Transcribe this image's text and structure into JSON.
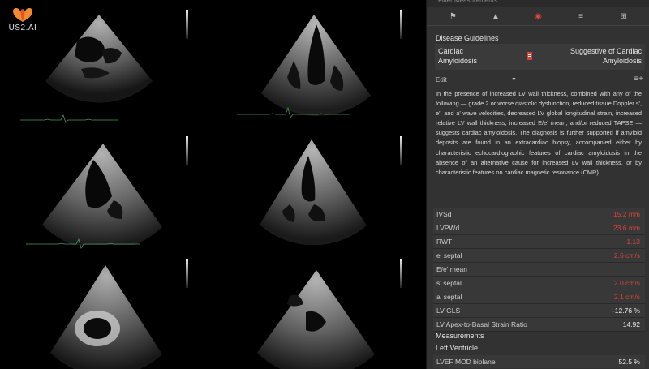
{
  "app": {
    "logo_text": "US2.AI"
  },
  "panel": {
    "filter_header": "Filter Measurements",
    "toolbar": {
      "icons": [
        "flag-icon",
        "warning-icon",
        "eye-icon",
        "menu-icon",
        "grid-icon"
      ],
      "active_icon": "eye-icon",
      "accent_color": "#e0463c"
    },
    "disease_guidelines": {
      "title": "Disease Guidelines",
      "left_line1": "Cardiac",
      "left_line2": "Amyloidosis",
      "right_line1": "Suggestive of Cardiac",
      "right_line2": "Amyloidosis"
    },
    "edit_label": "Edit",
    "guideline_text": "In the presence of increased LV wall thickness, combined with any of the following — grade 2 or worse diastolic dysfunction, reduced tissue Doppler s', e', and a' wave velocities, decreased LV global longitudinal strain, increased relative LV wall thickness, increased E/e' mean, and/or reduced TAPSE — suggests cardiac amyloidosis. The diagnosis is further supported if amyloid deposits are found in an extracardiac biopsy, accompanied either by characteristic echocardiographic features of cardiac amyloidosis in the absence of an alternative cause for increased LV wall thickness, or by characteristic features on cardiac magnetic resonance (CMR).",
    "measurements_rows": [
      {
        "label": "IVSd",
        "value": "15.2 mm",
        "color": "red"
      },
      {
        "label": "LVPWd",
        "value": "23.6 mm",
        "color": "red"
      },
      {
        "label": "RWT",
        "value": "1.13",
        "color": "red"
      },
      {
        "label": "e' septal",
        "value": "2.6 cm/s",
        "color": "red"
      },
      {
        "label": "E/e' mean",
        "value": "",
        "color": "white"
      },
      {
        "label": "s' septal",
        "value": "2.0 cm/s",
        "color": "red"
      },
      {
        "label": "a' septal",
        "value": "2.1 cm/s",
        "color": "red"
      },
      {
        "label": "LV GLS",
        "value": "-12.76 %",
        "color": "white"
      },
      {
        "label": "LV Apex-to-Basal Strain Ratio",
        "value": "14.92",
        "color": "white"
      }
    ],
    "measurements_title": "Measurements",
    "left_ventricle_title": "Left Ventricle",
    "lvef": {
      "label": "LVEF MOD biplane",
      "value": "52.5 %"
    }
  },
  "colors": {
    "abnormal": "#d9443a",
    "normal": "#ededed",
    "panel_bg": "#323232"
  }
}
